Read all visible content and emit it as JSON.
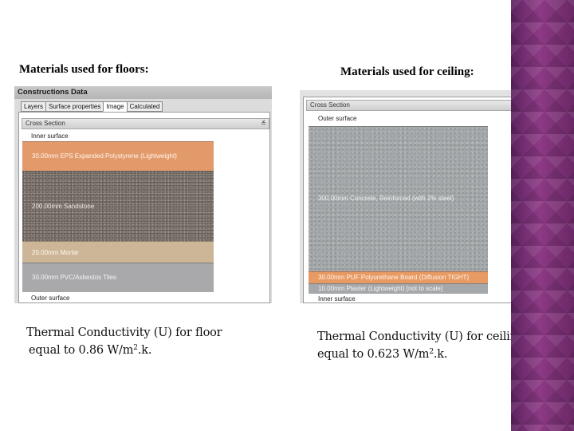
{
  "floors": {
    "heading": "Materials used for floors:",
    "caption_line1": "Thermal Conductivity (U) for floor",
    "caption_line2_before": "equal to 0.86 W/m",
    "caption_sup": "2",
    "caption_line2_after": ".k.",
    "screenshot": {
      "title": "Constructions Data",
      "tabs": [
        "Layers",
        "Surface properties",
        "Image",
        "Calculated"
      ],
      "active_tab": "Image",
      "section_header": "Cross Section",
      "inner_surface": "Inner surface",
      "outer_surface": "Outer surface",
      "layers": [
        {
          "label": "30.00mm    EPS Expanded Polystyrene (Lightweight)",
          "color": "#e39a6b"
        },
        {
          "label": "200.00mm    Sandstone",
          "color": "#8a817b"
        },
        {
          "label": "20.00mm    Mortar",
          "color": "#cdb697"
        },
        {
          "label": "30.00mm    PVC/Asbestos Tiles",
          "color": "#a9a9ab"
        }
      ]
    }
  },
  "ceiling": {
    "heading": "Materials used for ceiling:",
    "caption_line1": "Thermal Conductivity (U) for ceiling",
    "caption_line2_before": "equal to 0.623 W/m",
    "caption_sup": "2",
    "caption_line2_after": ".k.",
    "screenshot": {
      "section_header": "Cross Section",
      "outer_surface": "Outer surface",
      "inner_surface": "Inner surface",
      "layers": [
        {
          "label": "300.00mm    Concrete, Reinforced (with 2% steel)",
          "color": "#a3a7a9"
        },
        {
          "label": "30.00mm    PUF Polyurethane Board (Diffusion TIGHT)",
          "color": "#e89a63"
        },
        {
          "label": "10.00mm    Plaster (Lightweight) [not to scale]",
          "color": "#a5a8ab"
        }
      ]
    }
  },
  "decor": {
    "sidebar_color": "#6d2a6b"
  }
}
